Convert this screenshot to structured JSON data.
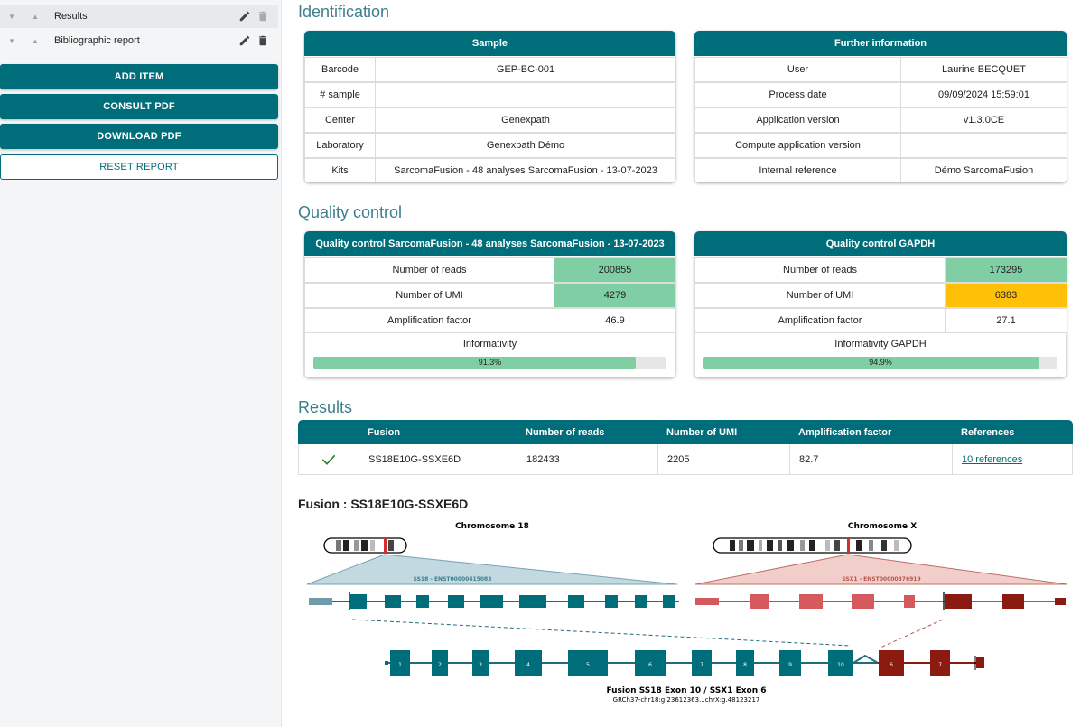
{
  "sidebar": {
    "items": [
      {
        "label": "Results"
      },
      {
        "label": "Bibliographic report"
      }
    ],
    "buttons": {
      "add_item": "ADD ITEM",
      "consult_pdf": "CONSULT PDF",
      "download_pdf": "DOWNLOAD PDF",
      "reset_report": "RESET REPORT"
    }
  },
  "identification": {
    "title": "Identification",
    "sample": {
      "header": "Sample",
      "rows": [
        {
          "label": "Barcode",
          "value": "GEP-BC-001"
        },
        {
          "label": "# sample",
          "value": ""
        },
        {
          "label": "Center",
          "value": "Genexpath"
        },
        {
          "label": "Laboratory",
          "value": "Genexpath Démo"
        },
        {
          "label": "Kits",
          "value": "SarcomaFusion - 48 analyses SarcomaFusion - 13-07-2023"
        }
      ]
    },
    "further": {
      "header": "Further information",
      "rows": [
        {
          "label": "User",
          "value": "Laurine BECQUET"
        },
        {
          "label": "Process date",
          "value": "09/09/2024 15:59:01"
        },
        {
          "label": "Application version",
          "value": "v1.3.0CE"
        },
        {
          "label": "Compute application version",
          "value": ""
        },
        {
          "label": "Internal reference",
          "value": "Démo SarcomaFusion"
        }
      ]
    }
  },
  "quality": {
    "title": "Quality control",
    "left": {
      "header": "Quality control SarcomaFusion - 48 analyses SarcomaFusion - 13-07-2023",
      "reads_label": "Number of reads",
      "reads": "200855",
      "umi_label": "Number of UMI",
      "umi": "4279",
      "amp_label": "Amplification factor",
      "amp": "46.9",
      "inf_label": "Informativity",
      "inf_text": "91.3%",
      "inf_value": 0.913
    },
    "right": {
      "header": "Quality control GAPDH",
      "reads_label": "Number of reads",
      "reads": "173295",
      "umi_label": "Number of UMI",
      "umi": "6383",
      "amp_label": "Amplification factor",
      "amp": "27.1",
      "inf_label": "Informativity GAPDH",
      "inf_text": "94.9%",
      "inf_value": 0.949
    },
    "colors": {
      "ok": "#80cfa4",
      "warn": "#ffc107"
    }
  },
  "results": {
    "title": "Results",
    "columns": [
      "Fusion",
      "Number of reads",
      "Number of UMI",
      "Amplification factor",
      "References"
    ],
    "row": {
      "fusion": "SS18E10G-SSXE6D",
      "reads": "182433",
      "umi": "2205",
      "amp": "82.7",
      "references": "10 references"
    }
  },
  "fusion": {
    "title": "Fusion : SS18E10G-SSXE6D",
    "chr_left": "Chromosome 18",
    "chr_right": "Chromosome X",
    "gene_left": "SS18 - ENST00000415083",
    "gene_right": "SSX1 - ENST00000376919",
    "exons_fused_left": [
      "1",
      "2",
      "3",
      "4",
      "5",
      "6",
      "7",
      "8",
      "9",
      "10"
    ],
    "exons_fused_right": [
      "6",
      "7"
    ],
    "caption": "Fusion SS18 Exon 10 / SSX1 Exon 6",
    "coords": "GRCh37-chr18:g.23612363...chrX:g.48123217",
    "colors": {
      "teal": "#006d7a",
      "red": "#8b1a10",
      "lightred": "#d45a5e",
      "lightteal": "#5e93a5"
    }
  }
}
